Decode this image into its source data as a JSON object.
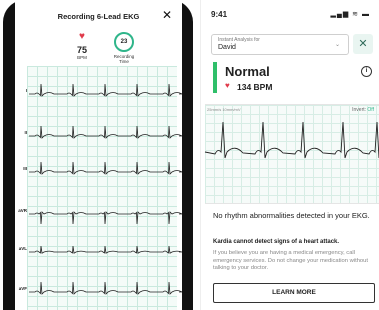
{
  "left": {
    "title": "Recording 6-Lead EKG",
    "close_glyph": "✕",
    "bpm_value": "75",
    "bpm_label": "BPM",
    "recording_time_value": "23",
    "recording_time_label_1": "Recording",
    "recording_time_label_2": "Time",
    "leads": [
      "I",
      "II",
      "III",
      "aVR",
      "aVL",
      "aVF"
    ]
  },
  "right": {
    "status_time": "9:41",
    "status_icons": "▂▄▆ ≋ ▬",
    "instant_analysis_label": "Instant Analysis for",
    "person_name": "David",
    "chevron": "⌄",
    "close_glyph": "✕",
    "result": "Normal",
    "info_glyph": "i",
    "bpm": "134 BPM",
    "scale_text": "25mm/s  10mm/mV",
    "invert_label": "Invert:",
    "invert_value": "Off",
    "message": "No rhythm abnormalities detected in your EKG.",
    "warning_title": "Kardia cannot detect signs of a heart attack.",
    "warning_desc": "If you believe you are having a medical emergency, call emergency services. Do not change your medication without talking to your doctor.",
    "learn_more": "LEARN MORE"
  },
  "icons": {
    "heart": "heart-icon",
    "close": "close-icon",
    "info": "info-icon",
    "chevron": "chevron-down-icon",
    "status": "status-icons"
  },
  "colors": {
    "normal_accent": "#2fbf6a",
    "heart": "#e03a4a",
    "ring": "#2fb58a",
    "grid": "#c9e9de"
  }
}
